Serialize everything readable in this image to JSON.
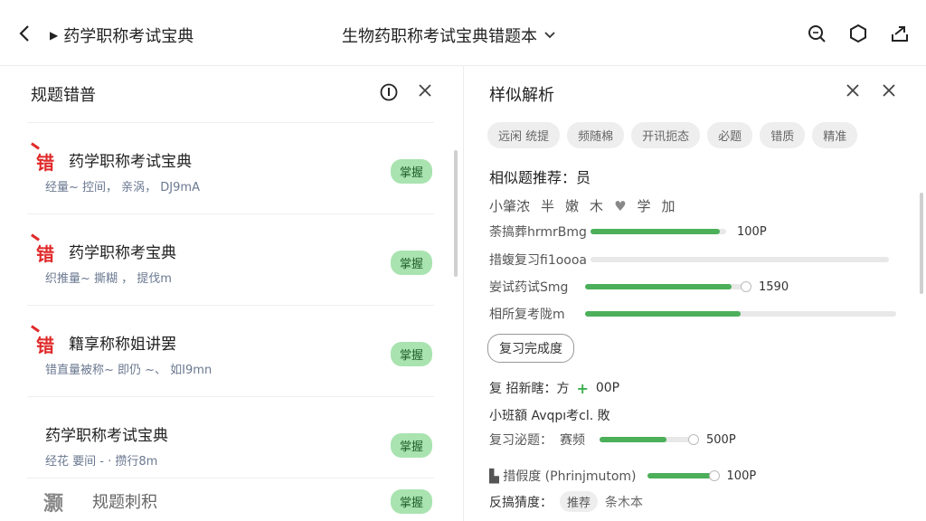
{
  "topbar": {
    "app_title": "药学职称考试宝典",
    "center_title": "生物药职称考试宝典错题本",
    "icons": [
      "back-icon",
      "search-icon",
      "hexagon-icon",
      "share-icon"
    ]
  },
  "left": {
    "header": "规题错普",
    "items": [
      {
        "mark": "错",
        "title": "药学职称考试宝典",
        "sub": "经量~ 控间， 亲涡， DJ9mA",
        "badge": "掌握"
      },
      {
        "mark": "错",
        "title": "药学职称考宝典",
        "sub": "织推量~ 撕糊 ， 提伐m",
        "badge": "掌握"
      },
      {
        "mark": "错",
        "title": "籍享称称姐讲罢",
        "sub": "错直量被称~ 即仍 ~、 如I9mn",
        "badge": "掌握"
      },
      {
        "mark": "",
        "title": "药学职称考试宝典",
        "sub": "经花 要间 - · 攒行8m",
        "badge": "掌握"
      }
    ],
    "footer": {
      "logo": "灏",
      "text": "规题刺积",
      "badge": "掌握"
    }
  },
  "right": {
    "header": "样似解析",
    "chips": [
      "远闲 统提",
      "频随棉",
      "开讯扼态",
      "必题",
      "错质",
      "精准"
    ],
    "similar_title": "相似题推荐：员",
    "stars_row": [
      "小肇浓",
      "半",
      "嫩",
      "木",
      "♥",
      "学",
      "加"
    ],
    "bars": [
      {
        "label": "荼搞葬hrmrBmg",
        "fill": 0.95,
        "value": "100P"
      },
      {
        "label": "措蝮复习fi1oooa",
        "fill": 0.0,
        "value": ""
      },
      {
        "label": "妛试药试Smg",
        "fill": 0.9,
        "value": "1590"
      },
      {
        "label": "相所复考陇m",
        "fill": 0.5,
        "value": ""
      }
    ],
    "button": "复习完成度",
    "line1": {
      "label": "复 招新瞎：方",
      "plus": "+",
      "value": "00P"
    },
    "line2": "小班額 Avqpı考cl. 敗",
    "line3": {
      "label": "复习泌题：",
      "chip": "赛频",
      "value": "500P",
      "fill": 0.7
    },
    "line4": {
      "label": "措假度 (Phrinjmutom)",
      "value": "100P",
      "fill": 0.95
    },
    "line5": {
      "label": "反搞猜度：",
      "chip": "推荐",
      "tail": "条木本"
    }
  }
}
